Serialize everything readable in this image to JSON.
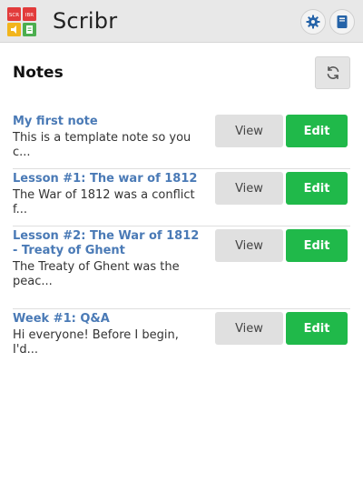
{
  "header": {
    "app_name": "Scribr",
    "logo_text_left": "SCR",
    "logo_text_right": "IBR",
    "settings_icon": "gear-icon",
    "book_icon": "book-icon",
    "accent_color": "#2563a8"
  },
  "page": {
    "title": "Notes",
    "refresh_icon": "refresh-icon"
  },
  "buttons": {
    "view_label": "View",
    "edit_label": "Edit",
    "edit_color": "#20b94a"
  },
  "notes": [
    {
      "title": "My first note",
      "preview": "This is a template note so you c..."
    },
    {
      "title": "Lesson #1: The war of 1812",
      "preview": "The War of 1812 was a conflict f..."
    },
    {
      "title": "Lesson #2: The War of 1812 - Treaty of Ghent",
      "preview": "The Treaty of Ghent was the peac..."
    },
    {
      "title": "Week #1: Q&A",
      "preview": "Hi everyone! Before I begin, I'd..."
    }
  ]
}
